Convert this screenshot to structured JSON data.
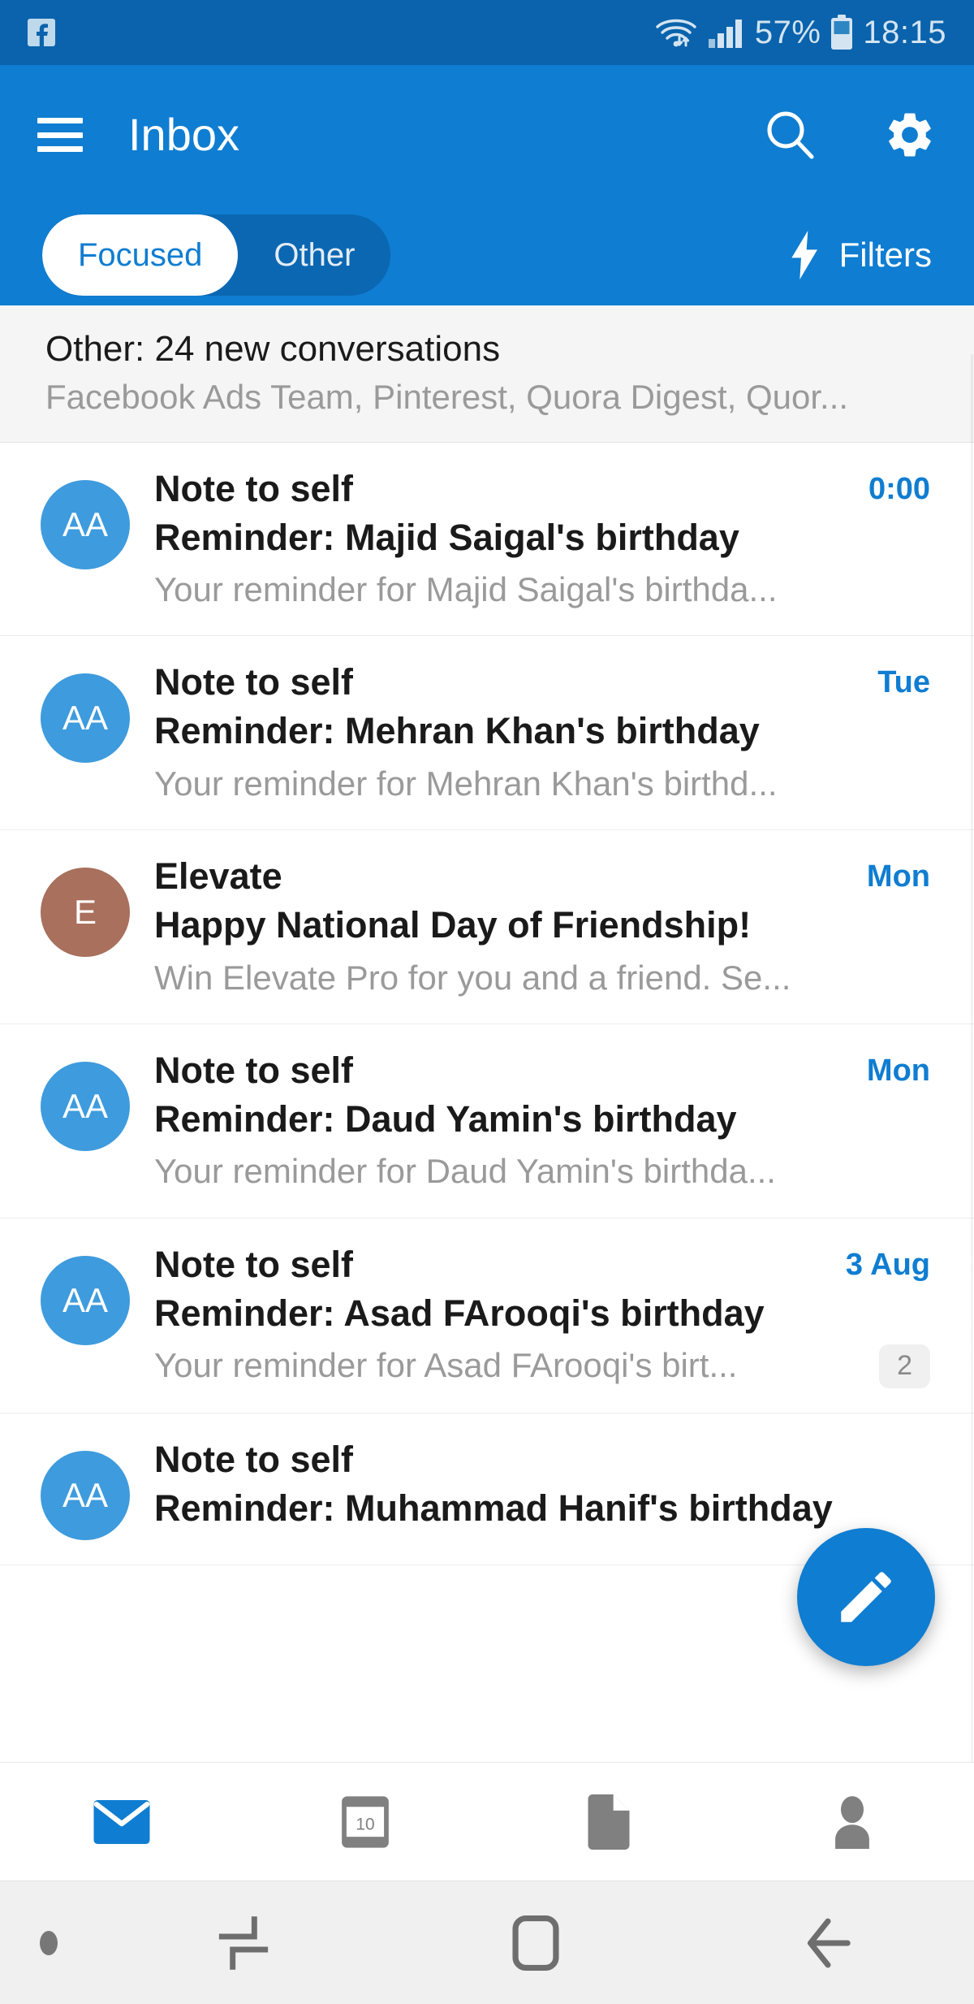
{
  "statusbar": {
    "notification_icon": "facebook-icon",
    "wifi_icon": "wifi-icon",
    "signal_icon": "cellular-signal-icon",
    "battery_percent": "57%",
    "battery_icon": "battery-icon",
    "clock": "18:15"
  },
  "appbar": {
    "menu_icon": "hamburger-menu-icon",
    "title": "Inbox",
    "search_icon": "search-icon",
    "settings_icon": "gear-icon"
  },
  "tabs": {
    "focused_label": "Focused",
    "other_label": "Other",
    "active": "Focused",
    "filters_label": "Filters",
    "filters_icon": "lightning-bolt-icon"
  },
  "section_header": {
    "title": "Other: 24 new conversations",
    "senders": "Facebook Ads Team, Pinterest, Quora Digest, Quor..."
  },
  "messages": [
    {
      "initials": "AA",
      "avatar_color": "#3E9BDD",
      "sender": "Note to self",
      "subject": "Reminder: Majid Saigal's birthday",
      "preview": "Your reminder for Majid Saigal's birthda...",
      "time": "0:00",
      "count": ""
    },
    {
      "initials": "AA",
      "avatar_color": "#3E9BDD",
      "sender": "Note to self",
      "subject": "Reminder: Mehran Khan's birthday",
      "preview": "Your reminder for Mehran Khan's birthd...",
      "time": "Tue",
      "count": ""
    },
    {
      "initials": "E",
      "avatar_color": "#A8705D",
      "sender": "Elevate",
      "subject": "Happy National Day of Friendship!",
      "preview": "Win Elevate Pro for you and a friend. Se...",
      "time": "Mon",
      "count": ""
    },
    {
      "initials": "AA",
      "avatar_color": "#3E9BDD",
      "sender": "Note to self",
      "subject": "Reminder: Daud Yamin's birthday",
      "preview": "Your reminder for Daud Yamin's birthda...",
      "time": "Mon",
      "count": ""
    },
    {
      "initials": "AA",
      "avatar_color": "#3E9BDD",
      "sender": "Note to self",
      "subject": "Reminder: Asad FArooqi's birthday",
      "preview": "Your reminder for Asad FArooqi's birt...",
      "time": "3 Aug",
      "count": "2"
    },
    {
      "initials": "AA",
      "avatar_color": "#3E9BDD",
      "sender": "Note to self",
      "subject": "Reminder: Muhammad Hanif's birthday",
      "preview": "",
      "time": "",
      "count": ""
    }
  ],
  "fab": {
    "icon": "compose-pencil-icon"
  },
  "bottom_nav": [
    {
      "icon": "mail-icon",
      "active": true
    },
    {
      "icon": "calendar-icon",
      "active": false,
      "day": "10"
    },
    {
      "icon": "files-icon",
      "active": false
    },
    {
      "icon": "people-icon",
      "active": false
    }
  ],
  "system_nav": {
    "dot_icon": "status-dot-icon",
    "recents_icon": "recents-icon",
    "home_icon": "home-icon",
    "back_icon": "back-arrow-icon"
  },
  "colors": {
    "status_bar": "#0A63AC",
    "app_bar": "#0F7DD1",
    "accent": "#0F7DD1",
    "pivot_inactive": "#0B67B2"
  }
}
